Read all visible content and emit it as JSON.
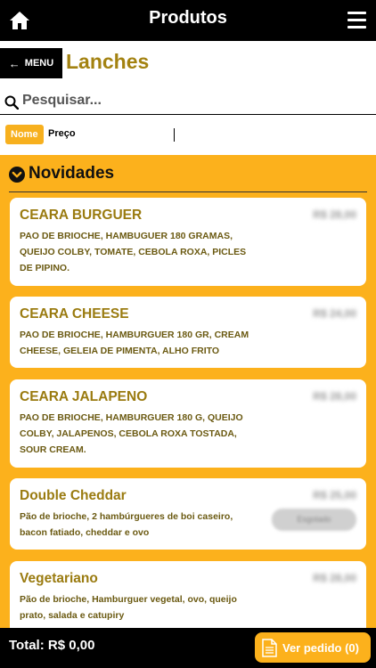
{
  "header": {
    "title": "Produtos",
    "home_icon": "home-icon",
    "menu_icon": "hamburger-menu-icon"
  },
  "category": {
    "back_label": "MENU",
    "back_icon": "arrow-left-icon",
    "title": "Lanches"
  },
  "search": {
    "placeholder": "Pesquisar...",
    "value": "",
    "icon": "search-icon"
  },
  "sort": {
    "name_label": "Nome",
    "price_label": "Preço"
  },
  "section": {
    "title": "Novidades",
    "icon": "chevron-down-circle-icon"
  },
  "products": [
    {
      "name": "CEARA BURGUER",
      "description": "PAO DE BRIOCHE, HAMBUGUER 180 GRAMAS, QUEIJO COLBY, TOMATE, CEBOLA ROXA, PICLES DE PIPINO.",
      "price": "R$ 28,00"
    },
    {
      "name": "CEARA CHEESE",
      "description": "PAO DE BRIOCHE, HAMBURGUER 180 GR, CREAM CHEESE, GELEIA DE PIMENTA, ALHO FRITO",
      "price": "R$ 24,00"
    },
    {
      "name": "CEARA JALAPENO",
      "description": "PAO DE BRIOCHE, HAMBURGUER 180 G, QUEIJO COLBY, JALAPENOS, CEBOLA ROXA TOSTADA, SOUR CREAM.",
      "price": "R$ 28,00"
    },
    {
      "name": "Double Cheddar",
      "description": "Pão de brioche, 2 hambúrgueres de boi caseiro, bacon fatiado, cheddar e ovo",
      "price": "R$ 25,00",
      "status": "Esgotado"
    },
    {
      "name": "Vegetariano",
      "description": "Pão de brioche, Hamburguer vegetal, ovo, queijo prato, salada e catupiry",
      "price": "R$ 28,00"
    }
  ],
  "footer": {
    "total_label": "Total: R$ 0,00",
    "order_label": "Ver pedido (0)",
    "order_icon": "document-icon"
  },
  "colors": {
    "accent": "#fcb11c",
    "title_gold": "#a38211",
    "bar": "#000000"
  }
}
